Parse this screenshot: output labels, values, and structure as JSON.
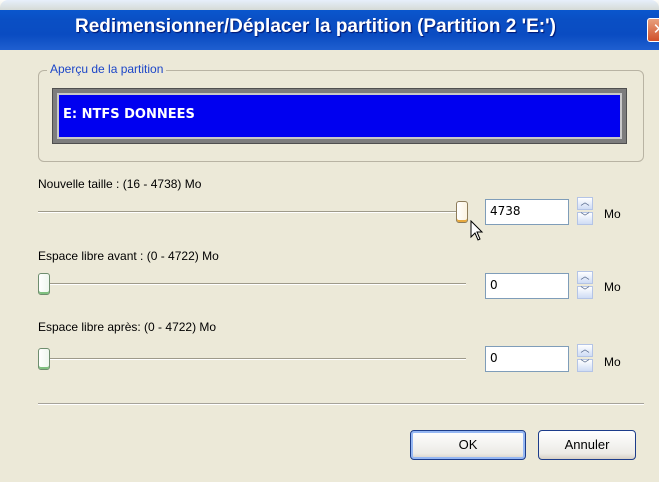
{
  "window": {
    "title": "Redimensionner/Déplacer la partition (Partition 2 'E:')",
    "close_symbol": "✕"
  },
  "preview": {
    "legend": "Aperçu de la partition",
    "partition_label": "E: NTFS DONNEES"
  },
  "new_size": {
    "label": "Nouvelle taille : (16 - 4738) Mo",
    "value": "4738",
    "unit": "Mo",
    "slider_fraction": 1.0
  },
  "free_before": {
    "label": "Espace libre avant : (0 - 4722) Mo",
    "value": "0",
    "unit": "Mo",
    "slider_fraction": 0.0
  },
  "free_after": {
    "label": "Espace libre après: (0 - 4722) Mo",
    "value": "0",
    "unit": "Mo",
    "slider_fraction": 0.0
  },
  "spin_up_symbol": "︿",
  "spin_down_symbol": "﹀",
  "buttons": {
    "ok_label": "OK",
    "cancel_label": "Annuler"
  },
  "colors": {
    "partition_bar": "#0000f0",
    "titlebar": "#0a4cc2"
  }
}
